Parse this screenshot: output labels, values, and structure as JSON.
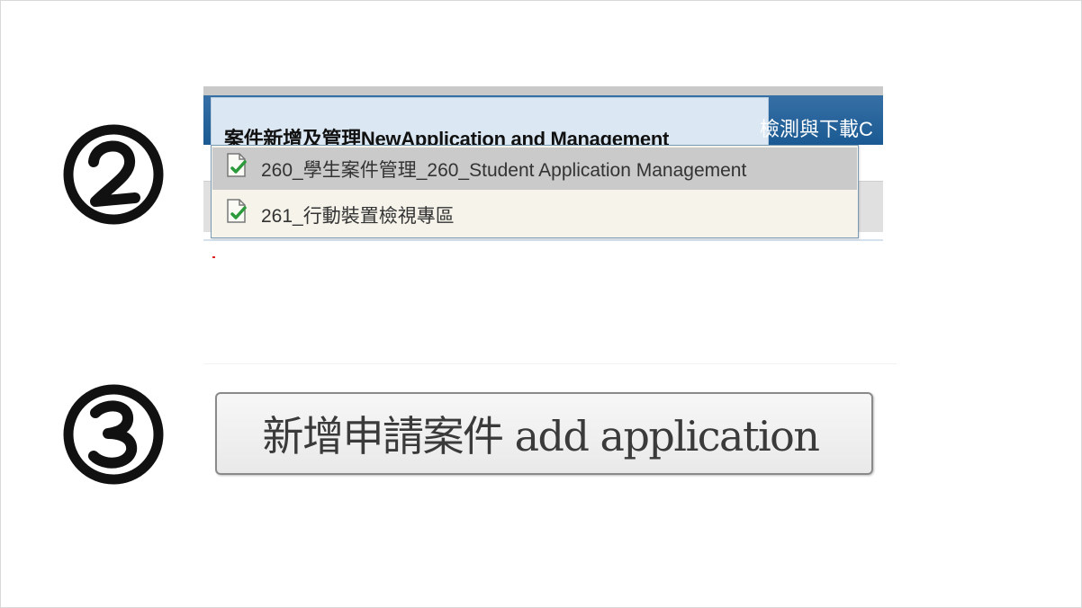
{
  "step_markers": [
    "②",
    "③"
  ],
  "menu": {
    "active_tab_label": "案件新增及管理NewApplication and Management",
    "next_tab_label": "檢測與下載C",
    "dropdown_items": [
      {
        "label": "260_學生案件管理_260_Student Application Management",
        "icon": "page-check-icon",
        "highlighted": true
      },
      {
        "label": "261_行動裝置檢視專區",
        "icon": "page-check-icon",
        "highlighted": false
      }
    ],
    "colors": {
      "menubar": "#1b5a93",
      "active_tab": "#dbe8f3",
      "dropdown_bg": "#f5f3ea",
      "hover": "#cacaca"
    }
  },
  "add_button": {
    "label": "新增申請案件 add application"
  }
}
